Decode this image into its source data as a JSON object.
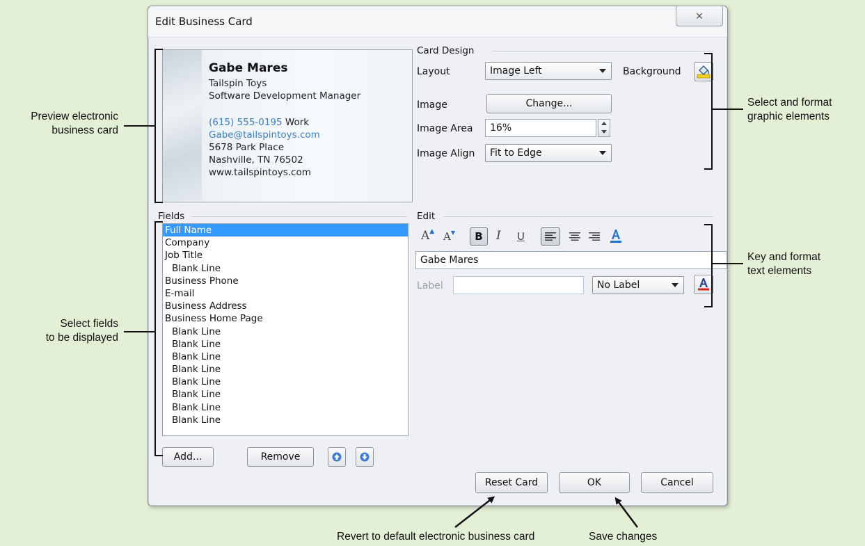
{
  "dialog": {
    "title": "Edit Business Card",
    "close_glyph": "✕"
  },
  "card_preview": {
    "name": "Gabe Mares",
    "company": "Tailspin Toys",
    "job_title": "Software Development Manager",
    "phone": "(615) 555-0195",
    "phone_label": "Work",
    "email": "Gabe@tailspintoys.com",
    "address1": "5678 Park Place",
    "address2": "Nashville, TN 76502",
    "website": "www.tailspintoys.com"
  },
  "card_design": {
    "group_label": "Card Design",
    "layout_label": "Layout",
    "layout_value": "Image Left",
    "background_label": "Background",
    "image_label": "Image",
    "change_button": "Change...",
    "image_area_label": "Image Area",
    "image_area_value": "16%",
    "image_align_label": "Image Align",
    "image_align_value": "Fit to Edge"
  },
  "fields": {
    "group_label": "Fields",
    "items": [
      "Full Name",
      "Company",
      "Job Title",
      "Blank Line",
      "Business Phone",
      "E-mail",
      "Business Address",
      "Business Home Page",
      "Blank Line",
      "Blank Line",
      "Blank Line",
      "Blank Line",
      "Blank Line",
      "Blank Line",
      "Blank Line",
      "Blank Line"
    ],
    "selected_index": 0,
    "add_button": "Add...",
    "remove_button": "Remove"
  },
  "edit": {
    "group_label": "Edit",
    "text_value": "Gabe Mares",
    "label_label": "Label",
    "label_value": "",
    "label_select_value": "No Label",
    "format_buttons": [
      "A",
      "A",
      "B",
      "I",
      "U"
    ]
  },
  "footer": {
    "reset_button": "Reset Card",
    "ok_button": "OK",
    "cancel_button": "Cancel"
  },
  "annotations": {
    "preview": [
      "Preview electronic",
      "business card"
    ],
    "select_fields": [
      "Select fields",
      "to be displayed"
    ],
    "graphic": [
      "Select and format",
      "graphic elements"
    ],
    "text": [
      "Key and format",
      "text elements"
    ],
    "revert": "Revert to default electronic business card",
    "save": "Save changes"
  },
  "colors": {
    "background": "#e4f0d6",
    "selection": "#3399ff",
    "link": "#3d7dc4",
    "underline_color": "#1f6fd0",
    "font_color_bar": "#d9261c"
  }
}
